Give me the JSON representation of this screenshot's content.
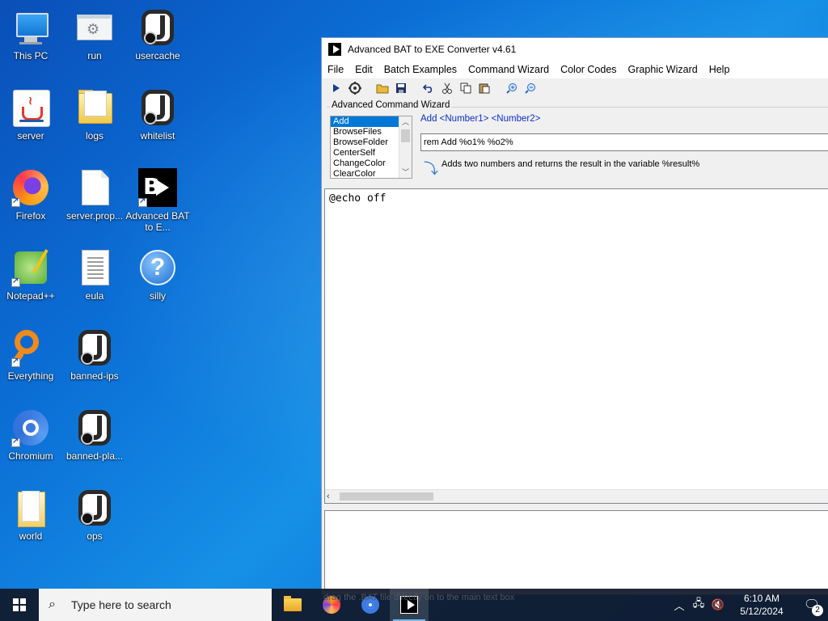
{
  "desktop": {
    "icons": [
      {
        "label": "This PC"
      },
      {
        "label": "run"
      },
      {
        "label": "usercache"
      },
      {
        "label": "server"
      },
      {
        "label": "logs"
      },
      {
        "label": "whitelist"
      },
      {
        "label": "Firefox"
      },
      {
        "label": "server.prop..."
      },
      {
        "label": "Advanced BAT to E..."
      },
      {
        "label": "Notepad++"
      },
      {
        "label": "eula"
      },
      {
        "label": "silly"
      },
      {
        "label": "Everything"
      },
      {
        "label": "banned-ips"
      },
      {
        "label": "Chromium"
      },
      {
        "label": "banned-pla..."
      },
      {
        "label": "world"
      },
      {
        "label": "ops"
      }
    ]
  },
  "window": {
    "title": "Advanced BAT to EXE Converter v4.61",
    "menu": [
      "File",
      "Edit",
      "Batch Examples",
      "Command Wizard",
      "Color Codes",
      "Graphic Wizard",
      "Help"
    ],
    "toolbar_icons": [
      "run-icon",
      "compile-icon",
      "open-icon",
      "save-icon",
      "undo-icon",
      "cut-icon",
      "copy-icon",
      "paste-icon",
      "zoom-in-icon",
      "zoom-out-icon"
    ],
    "wizard": {
      "legend": "Advanced Command Wizard",
      "commands": [
        "Add",
        "BrowseFiles",
        "BrowseFolder",
        "CenterSelf",
        "ChangeColor",
        "ClearColor"
      ],
      "selected": "Add",
      "syntax": "Add  <Number1>  <Number2>",
      "input_value": "rem Add %o1% %o2%",
      "description": "Adds two numbers and returns the result in the variable %result%"
    },
    "editor_text": "@echo off",
    "status_text": "drag the .BAT file directly on to the main text box"
  },
  "taskbar": {
    "search_placeholder": "Type here to search",
    "time": "6:10 AM",
    "date": "5/12/2024",
    "notification_count": "2"
  }
}
